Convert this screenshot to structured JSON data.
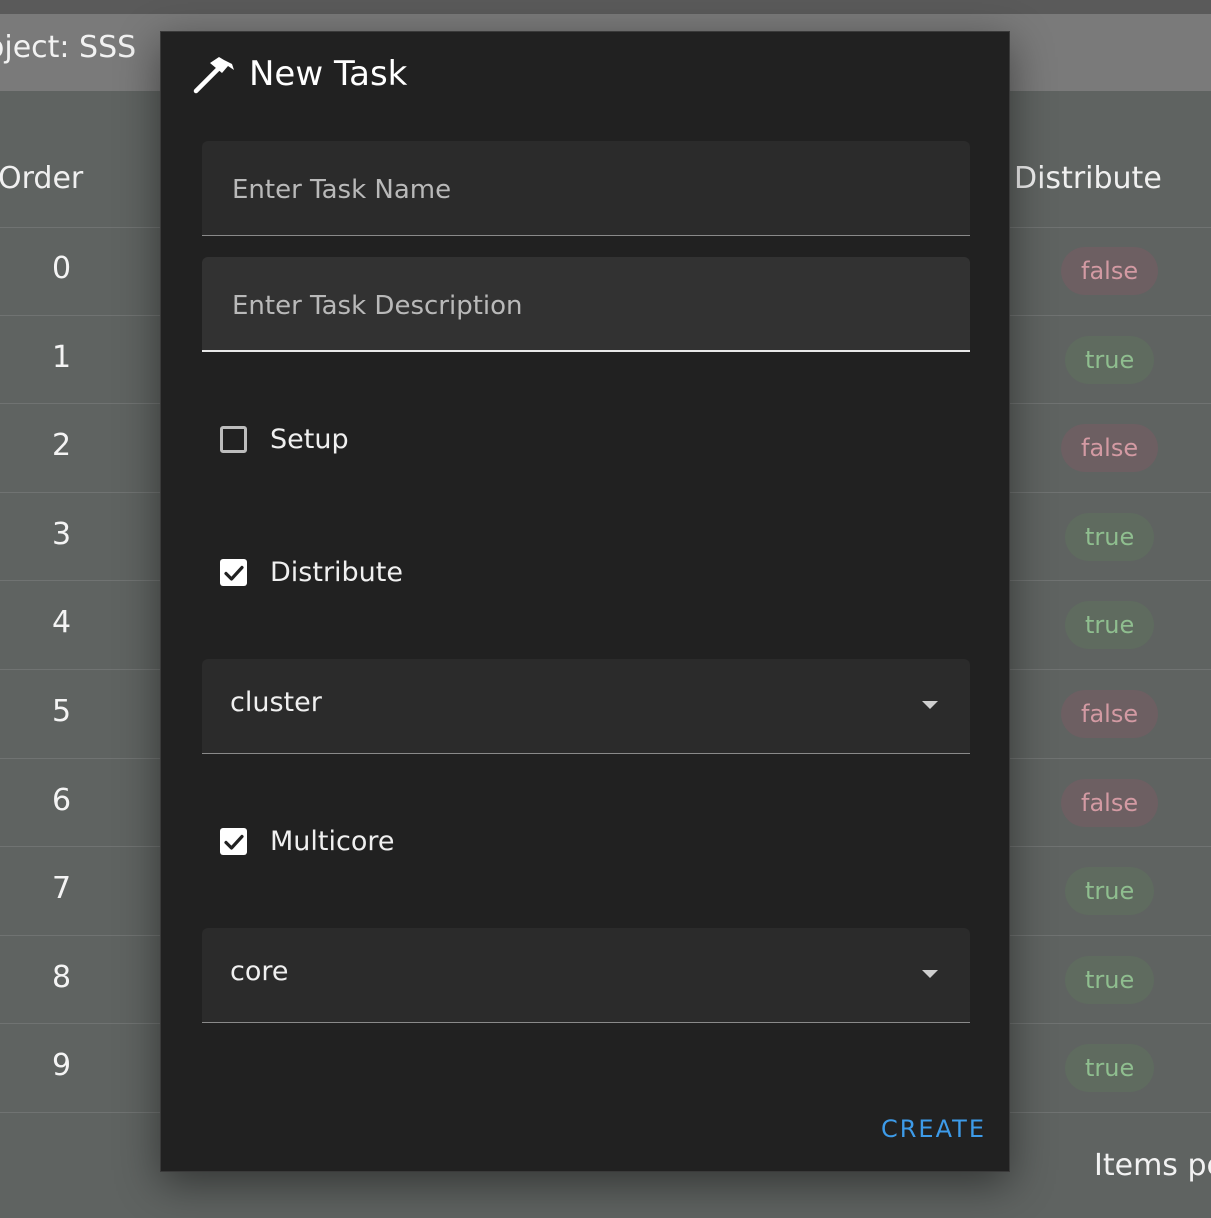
{
  "background": {
    "project_label": "oject: SSS",
    "columns": {
      "order": "Order",
      "distribute": "Distribute"
    },
    "rows": [
      {
        "order": "0",
        "distribute": "false"
      },
      {
        "order": "1",
        "distribute": "true"
      },
      {
        "order": "2",
        "distribute": "false"
      },
      {
        "order": "3",
        "distribute": "true"
      },
      {
        "order": "4",
        "distribute": "true"
      },
      {
        "order": "5",
        "distribute": "false"
      },
      {
        "order": "6",
        "distribute": "false"
      },
      {
        "order": "7",
        "distribute": "true"
      },
      {
        "order": "8",
        "distribute": "true"
      },
      {
        "order": "9",
        "distribute": "true"
      }
    ],
    "footer_text": "Items pe"
  },
  "dialog": {
    "title": "New Task",
    "title_icon": "hammer-icon",
    "task_name": {
      "value": "",
      "placeholder": "Enter Task Name"
    },
    "task_description": {
      "value": "",
      "placeholder": "Enter Task Description"
    },
    "setup": {
      "label": "Setup",
      "checked": false
    },
    "distribute": {
      "label": "Distribute",
      "checked": true
    },
    "distribute_select": {
      "value": "cluster"
    },
    "multicore": {
      "label": "Multicore",
      "checked": true
    },
    "multicore_select": {
      "value": "core"
    },
    "create_label": "CREATE"
  },
  "colors": {
    "accent": "#3d9be9",
    "dialog_bg": "#212121",
    "field_bg": "#2b2b2b",
    "chip_false_text": "#d39aa3",
    "chip_true_text": "#8fbe8f"
  }
}
